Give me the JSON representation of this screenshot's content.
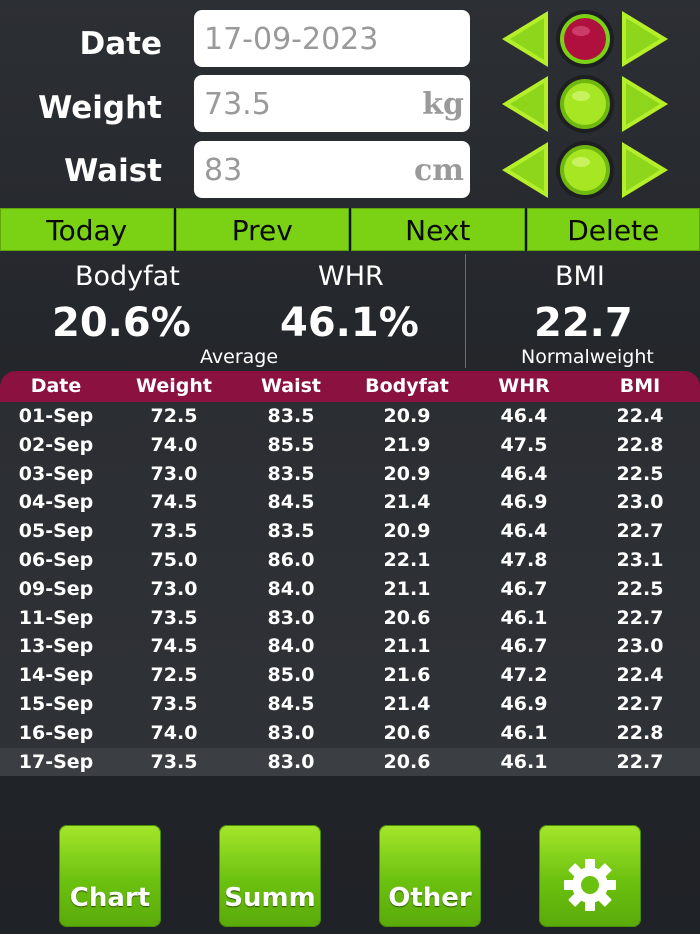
{
  "labels": {
    "date": "Date",
    "weight": "Weight",
    "waist": "Waist"
  },
  "inputs": {
    "date": {
      "value": "17-09-2023"
    },
    "weight": {
      "value": "73.5",
      "unit": "kg"
    },
    "waist": {
      "value": "83",
      "unit": "cm"
    }
  },
  "indicators": {
    "date": {
      "color": "#b0103e",
      "name": "red"
    },
    "weight": {
      "color": "#9be020",
      "name": "green"
    },
    "waist": {
      "color": "#9be020",
      "name": "green"
    }
  },
  "tabs": [
    "Today",
    "Prev",
    "Next",
    "Delete"
  ],
  "stats": {
    "bodyfat_label": "Bodyfat",
    "bodyfat_value": "20.6%",
    "whr_label": "WHR",
    "whr_value": "46.1%",
    "avg_label": "Average",
    "bmi_label": "BMI",
    "bmi_value": "22.7",
    "bmi_status": "Normalweight"
  },
  "table": {
    "headers": [
      "Date",
      "Weight",
      "Waist",
      "Bodyfat",
      "WHR",
      "BMI"
    ],
    "rows": [
      [
        "01-Sep",
        "72.5",
        "83.5",
        "20.9",
        "46.4",
        "22.4"
      ],
      [
        "02-Sep",
        "74.0",
        "85.5",
        "21.9",
        "47.5",
        "22.8"
      ],
      [
        "03-Sep",
        "73.0",
        "83.5",
        "20.9",
        "46.4",
        "22.5"
      ],
      [
        "04-Sep",
        "74.5",
        "84.5",
        "21.4",
        "46.9",
        "23.0"
      ],
      [
        "05-Sep",
        "73.5",
        "83.5",
        "20.9",
        "46.4",
        "22.7"
      ],
      [
        "06-Sep",
        "75.0",
        "86.0",
        "22.1",
        "47.8",
        "23.1"
      ],
      [
        "09-Sep",
        "73.0",
        "84.0",
        "21.1",
        "46.7",
        "22.5"
      ],
      [
        "11-Sep",
        "73.5",
        "83.0",
        "20.6",
        "46.1",
        "22.7"
      ],
      [
        "13-Sep",
        "74.5",
        "84.0",
        "21.1",
        "46.7",
        "23.0"
      ],
      [
        "14-Sep",
        "72.5",
        "85.0",
        "21.6",
        "47.2",
        "22.4"
      ],
      [
        "15-Sep",
        "73.5",
        "84.5",
        "21.4",
        "46.9",
        "22.7"
      ],
      [
        "16-Sep",
        "74.0",
        "83.0",
        "20.6",
        "46.1",
        "22.8"
      ],
      [
        "17-Sep",
        "73.5",
        "83.0",
        "20.6",
        "46.1",
        "22.7"
      ]
    ]
  },
  "footer": {
    "chart": "Chart",
    "summ": "Summ",
    "other": "Other",
    "settings_icon": "gear-icon"
  },
  "colors": {
    "accent": "#7bd114",
    "header": "#8a1140"
  }
}
